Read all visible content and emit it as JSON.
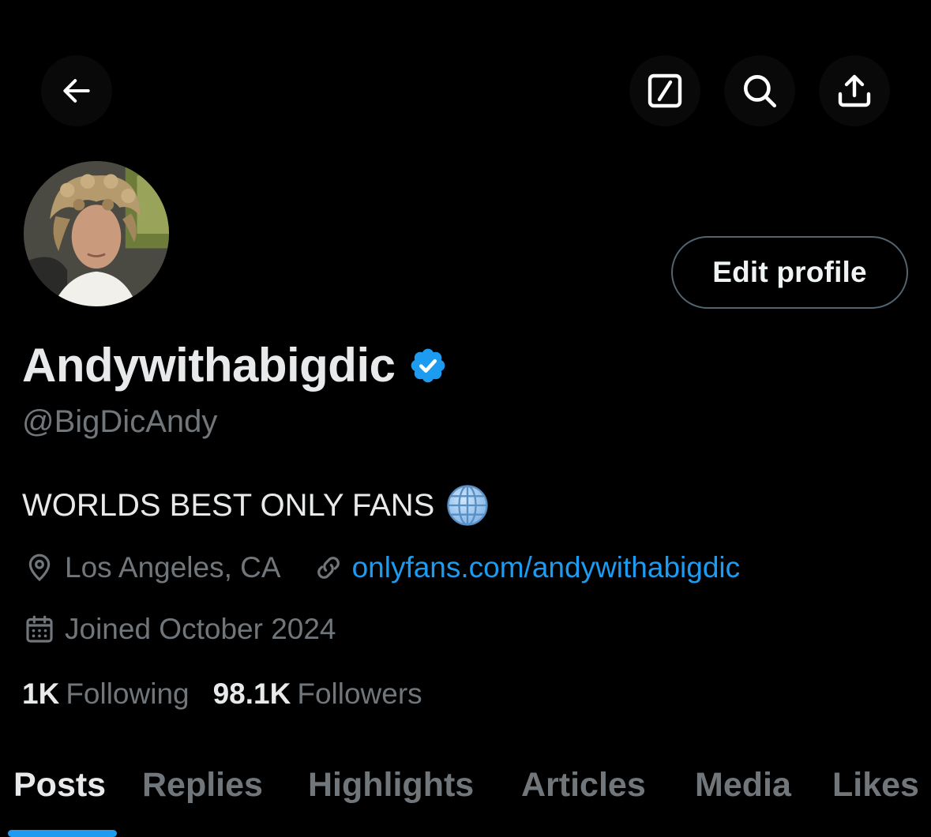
{
  "profile": {
    "display_name": "Andywithabigdic",
    "handle": "@BigDicAndy",
    "bio": "WORLDS BEST ONLY FANS",
    "location": "Los Angeles, CA",
    "website": "onlyfans.com/andywithabigdic",
    "joined": "Joined October 2024",
    "edit_label": "Edit profile",
    "following_count": "1K",
    "following_label": "Following",
    "followers_count": "98.1K",
    "followers_label": "Followers"
  },
  "tabs": [
    {
      "label": "Posts",
      "active": true
    },
    {
      "label": "Replies",
      "active": false
    },
    {
      "label": "Highlights",
      "active": false
    },
    {
      "label": "Articles",
      "active": false
    },
    {
      "label": "Media",
      "active": false
    },
    {
      "label": "Likes",
      "active": false
    }
  ],
  "icons": {
    "back": "arrow-left-icon",
    "edit": "edit-square-icon",
    "search": "search-icon",
    "share": "share-icon",
    "verified": "verified-badge-icon",
    "globe": "globe-emoji-icon",
    "location": "location-pin-icon",
    "link": "link-icon",
    "calendar": "calendar-icon"
  },
  "colors": {
    "accent": "#1d9bf0",
    "muted": "#71767b",
    "text": "#e7e9ea",
    "background": "#000000"
  }
}
